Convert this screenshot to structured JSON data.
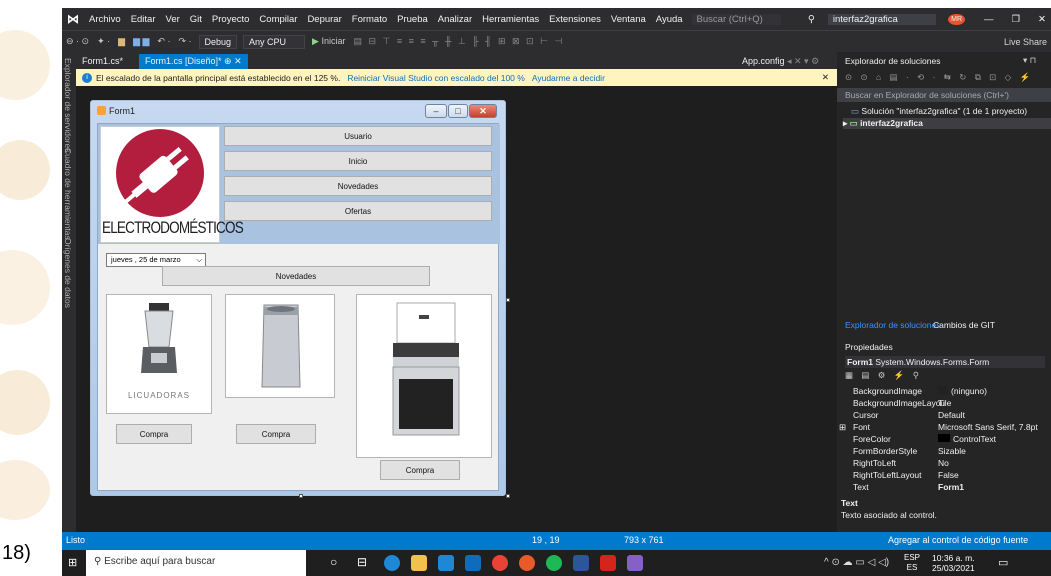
{
  "slide_label": "18)",
  "menu": [
    "Archivo",
    "Editar",
    "Ver",
    "Git",
    "Proyecto",
    "Compilar",
    "Depurar",
    "Formato",
    "Prueba",
    "Analizar",
    "Herramientas",
    "Extensiones",
    "Ventana",
    "Ayuda"
  ],
  "search_placeholder": "Buscar (Ctrl+Q)",
  "solution_title": "interfaz2grafica",
  "user_initials": "MR",
  "toolbar": {
    "config": "Debug",
    "platform": "Any CPU",
    "start": "Iniciar",
    "live_share": "Live Share"
  },
  "sidetabs": [
    "Explorador de servidores",
    "Cuadro de herramientas",
    "Orígenes de datos"
  ],
  "tabs": [
    "Form1.cs*",
    "Form1.cs [Diseño]*",
    "App.config"
  ],
  "infobar": {
    "message": "El escalado de la pantalla principal está establecido en el 125 %.",
    "link1": "Reiniciar Visual Studio con escalado del 100 %",
    "link2": "Ayudarme a decidir"
  },
  "form": {
    "title": "Form1",
    "logo_text": "ELECTRODOMÉSTICOS",
    "buttons": [
      "Usuario",
      "Inicio",
      "Novedades",
      "Ofertas"
    ],
    "date": "jueves , 25 de   marzo",
    "novedades": "Novedades",
    "blender_label": "LICUADORAS",
    "compra": [
      "Compra",
      "Compra",
      "Compra"
    ]
  },
  "solution": {
    "title": "Explorador de soluciones",
    "search_placeholder": "Buscar en Explorador de soluciones (Ctrl+')",
    "node": "Solución \"interfaz2grafica\" (1 de 1 proyecto)",
    "project": "interfaz2grafica",
    "bottom_tabs": [
      "Explorador de soluciones",
      "Cambios de GIT"
    ]
  },
  "properties": {
    "title": "Propiedades",
    "object": "Form1",
    "object_type": "System.Windows.Forms.Form",
    "rows": [
      {
        "name": "BackgroundImage",
        "value": "(ninguno)"
      },
      {
        "name": "BackgroundImageLayou",
        "value": "Tile"
      },
      {
        "name": "Cursor",
        "value": "Default"
      },
      {
        "name": "Font",
        "value": "Microsoft Sans Serif, 7.8pt"
      },
      {
        "name": "ForeColor",
        "value": "ControlText"
      },
      {
        "name": "FormBorderStyle",
        "value": "Sizable"
      },
      {
        "name": "RightToLeft",
        "value": "No"
      },
      {
        "name": "RightToLeftLayout",
        "value": "False"
      },
      {
        "name": "Text",
        "value": "Form1"
      }
    ],
    "desc_title": "Text",
    "desc_text": "Texto asociado al control."
  },
  "status": {
    "ready": "Listo",
    "position": "19 , 19",
    "size": "793 x 761",
    "source_control": "Agregar al control de código fuente"
  },
  "taskbar": {
    "search_placeholder": "Escribe aquí para buscar",
    "lang": "ESP",
    "region": "ES",
    "time": "10:36 a. m.",
    "date": "25/03/2021"
  }
}
